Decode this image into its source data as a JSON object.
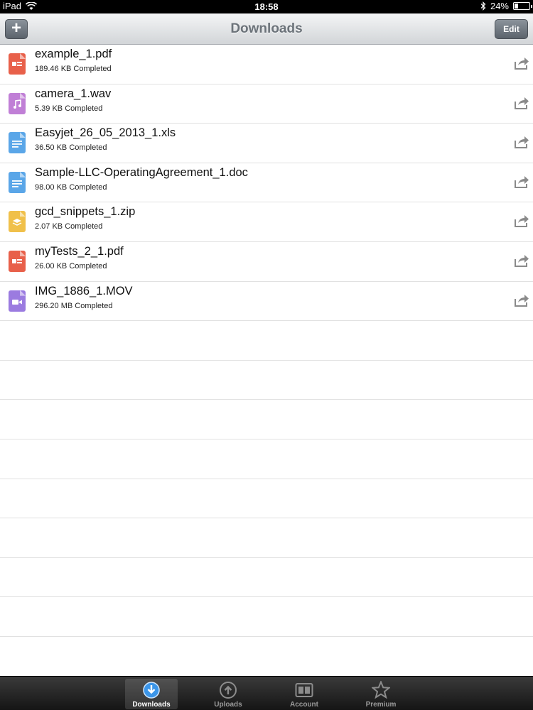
{
  "status_bar": {
    "device": "iPad",
    "time": "18:58",
    "battery": "24%",
    "battery_level": 0.24
  },
  "nav": {
    "title": "Downloads",
    "add_label": "+",
    "edit_label": "Edit"
  },
  "files": [
    {
      "name": "example_1.pdf",
      "status": "189.46 KB Completed",
      "icon": "pdf-file-icon",
      "color": "#e8604a"
    },
    {
      "name": "camera_1.wav",
      "status": "5.39 KB Completed",
      "icon": "audio-file-icon",
      "color": "#c07fd6"
    },
    {
      "name": "Easyjet_26_05_2013_1.xls",
      "status": "36.50 KB Completed",
      "icon": "document-file-icon",
      "color": "#5aa6e8"
    },
    {
      "name": "Sample-LLC-OperatingAgreement_1.doc",
      "status": "98.00 KB Completed",
      "icon": "document-file-icon",
      "color": "#5aa6e8"
    },
    {
      "name": "gcd_snippets_1.zip",
      "status": "2.07 KB Completed",
      "icon": "archive-file-icon",
      "color": "#f0c04a"
    },
    {
      "name": "myTests_2_1.pdf",
      "status": "26.00 KB Completed",
      "icon": "pdf-file-icon",
      "color": "#e8604a"
    },
    {
      "name": "IMG_1886_1.MOV",
      "status": "296.20 MB Completed",
      "icon": "video-file-icon",
      "color": "#9b7be0"
    }
  ],
  "tabs": [
    {
      "label": "Downloads",
      "icon": "download-icon",
      "active": true
    },
    {
      "label": "Uploads",
      "icon": "upload-icon",
      "active": false
    },
    {
      "label": "Account",
      "icon": "account-icon",
      "active": false
    },
    {
      "label": "Premium",
      "icon": "star-icon",
      "active": false
    }
  ]
}
